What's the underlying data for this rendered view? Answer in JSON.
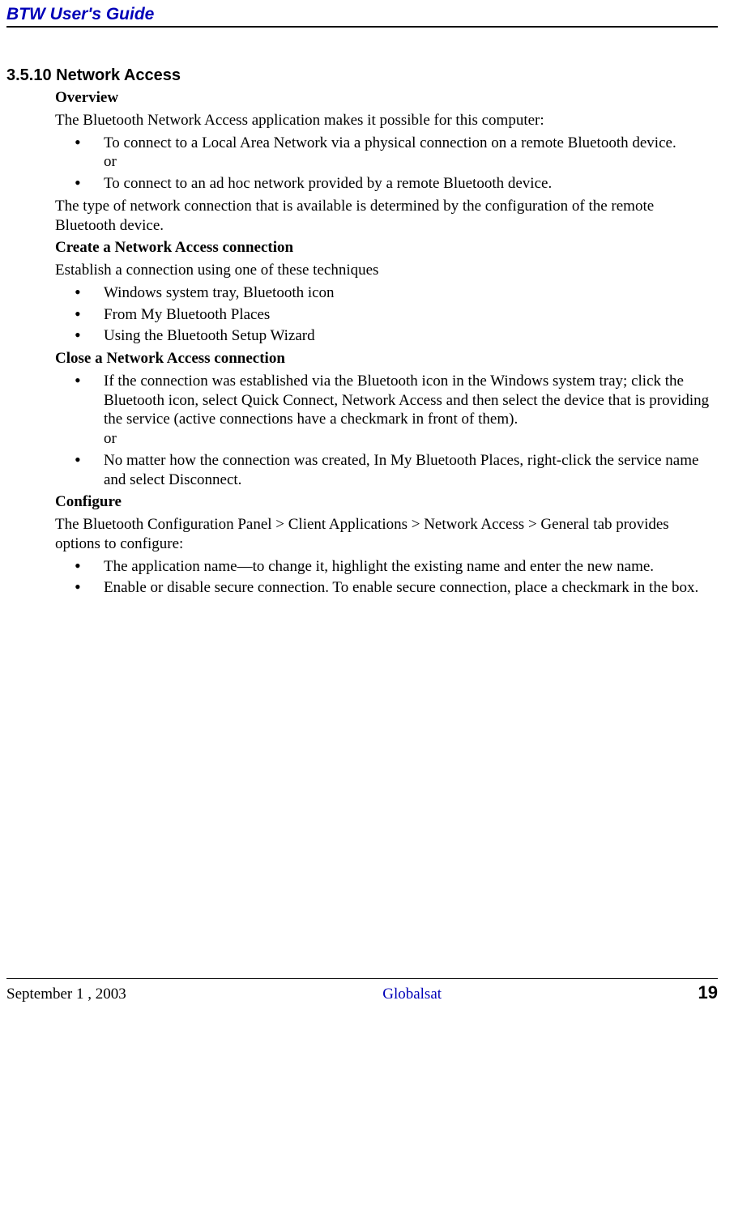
{
  "header": {
    "title": "BTW User's Guide"
  },
  "section": {
    "number_title": "3.5.10  Network Access",
    "overview_heading": "Overview",
    "overview_text": "The Bluetooth Network Access application makes it possible for this computer:",
    "overview_bullets": [
      "To connect to a Local Area Network via a physical connection on a remote Bluetooth device.\nor",
      "To connect to an ad hoc network provided by a remote Bluetooth device."
    ],
    "overview_footer": "The type of network connection that is available is determined by the configuration of the remote Bluetooth device.",
    "create_heading": "Create a Network Access connection",
    "create_text": "Establish a connection using one of these techniques",
    "create_bullets": [
      "Windows system tray, Bluetooth icon",
      "From My Bluetooth Places",
      "Using the Bluetooth Setup Wizard"
    ],
    "close_heading": "Close a Network Access connection",
    "close_bullets": [
      "If the connection was established via the Bluetooth icon in the Windows system tray; click the Bluetooth icon, select Quick Connect, Network Access and then select the device that is providing the service (active connections have a checkmark in front of them).\nor",
      "No matter how the connection was created, In My Bluetooth Places, right-click the service name and select Disconnect."
    ],
    "configure_heading": "Configure",
    "configure_text": "The Bluetooth Configuration Panel > Client Applications > Network Access > General tab provides options to configure:",
    "configure_bullets": [
      "The application name—to change it, highlight the existing name and enter the new name.",
      "Enable or disable secure connection. To enable secure connection, place a checkmark in the box."
    ]
  },
  "footer": {
    "left": "September 1 , 2003",
    "center": "Globalsat",
    "right": "19"
  }
}
